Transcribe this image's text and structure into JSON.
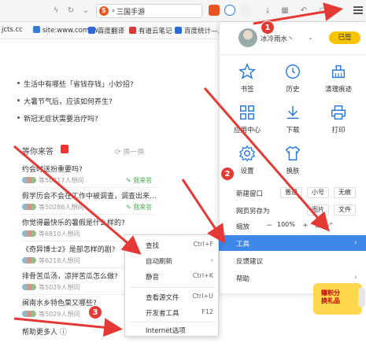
{
  "toolbar": {
    "tab_title": "三国手游",
    "accent": "#e8541e"
  },
  "bookmarks": {
    "url_fragment": "jcts.cc",
    "items": [
      "site:www.comcw...",
      "百度翻译",
      "有道云笔记",
      "百度统计—..."
    ]
  },
  "content": {
    "top_questions": [
      "生活中有哪些「省钱存钱」小妙招?",
      "大暑节气后，应该如何养生?",
      "新冠无症状需要治疗吗?"
    ],
    "section_title": "等你来答",
    "refresh_label": "换一换",
    "questions": [
      {
        "title": "约会时送扮重要吗?",
        "meta": "等50317人想问",
        "answer": "我来答"
      },
      {
        "title": "假学历会不会在工作中被调查，调查出来...",
        "meta": "等50286人想问",
        "answer": "我来答"
      },
      {
        "title": "你觉得最快乐的暑假是什么样的?",
        "meta": "等6810人想问",
        "answer": ""
      },
      {
        "title": "《奇异博士2》是部怎样的剧?",
        "meta": "等6218人想问",
        "answer": ""
      },
      {
        "title": "排骨苦瓜汤，凉拌苦瓜怎么做?",
        "meta": "等5029人想问",
        "answer": ""
      },
      {
        "title": "闽南水乡特色菜又哪些?",
        "meta": "等5029人想问",
        "answer": ""
      }
    ],
    "help_more": "帮助更多人"
  },
  "menu": {
    "username": "冰冷雨水丶",
    "signin": "已签",
    "grid": [
      {
        "label": "书签",
        "icon": "star-icon"
      },
      {
        "label": "历史",
        "icon": "clock-icon"
      },
      {
        "label": "清理痕迹",
        "icon": "broom-icon"
      },
      {
        "label": "应用中心",
        "icon": "apps-icon"
      },
      {
        "label": "下载",
        "icon": "download-icon"
      },
      {
        "label": "打印",
        "icon": "printer-icon"
      },
      {
        "label": "设置",
        "icon": "gear-icon"
      },
      {
        "label": "换肤",
        "icon": "shirt-icon"
      }
    ],
    "new_window": {
      "label": "新建窗口",
      "options": [
        "普通",
        "小号",
        "无痕"
      ]
    },
    "save_as": {
      "label": "网页另存为",
      "options": [
        "图片",
        "文件"
      ]
    },
    "zoom": {
      "label": "缩放",
      "value": "100%"
    },
    "tools": "工具",
    "feedback": "反馈建议",
    "help": "帮助"
  },
  "submenu": {
    "items": [
      {
        "label": "查找",
        "key": "Ctrl+F"
      },
      {
        "label": "自动刷新",
        "key": "›"
      },
      {
        "label": "静音",
        "key": "Ctrl+K"
      },
      {
        "label": "查看源文件",
        "key": "Ctrl+U"
      },
      {
        "label": "开发者工具",
        "key": "F12"
      },
      {
        "label": "Internet选项",
        "key": ""
      }
    ]
  },
  "annotations": [
    "1",
    "2",
    "3"
  ],
  "promo": {
    "line1": "赚积分",
    "line2": "换礼品"
  }
}
